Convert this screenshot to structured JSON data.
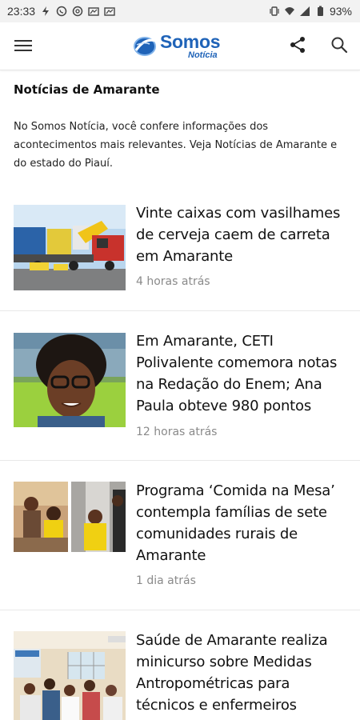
{
  "status_bar": {
    "time": "23:33",
    "battery": "93%",
    "icons": [
      "flash-icon",
      "whatsapp-icon",
      "threads-icon",
      "gallery-icon",
      "gallery-icon",
      "vibrate-icon",
      "wifi-icon",
      "signal-icon",
      "battery-icon"
    ]
  },
  "header": {
    "logo_main": "Somos",
    "logo_sub": "Notícia",
    "brand_color": "#1f63b8"
  },
  "intro": {
    "title": "Notícias de Amarante",
    "text": "No Somos Notícia, você confere informações dos acontecimentos mais relevantes. Veja Notícias de Amarante e do estado do Piauí."
  },
  "articles": [
    {
      "title": "Vinte caixas com vasilhames de cerveja caem de carreta em Amarante",
      "time": "4 horas atrás"
    },
    {
      "title": "Em Amarante, CETI Polivalente comemora notas na Redação do Enem; Ana Paula obteve 980 pontos",
      "time": "12 horas atrás"
    },
    {
      "title": "Programa ‘Comida na Mesa’ contempla famílias de sete comunidades rurais de Amarante",
      "time": "1 dia atrás"
    },
    {
      "title": "Saúde de Amarante realiza minicurso sobre Medidas Antropométricas para técnicos e enfermeiros",
      "time": ""
    }
  ]
}
